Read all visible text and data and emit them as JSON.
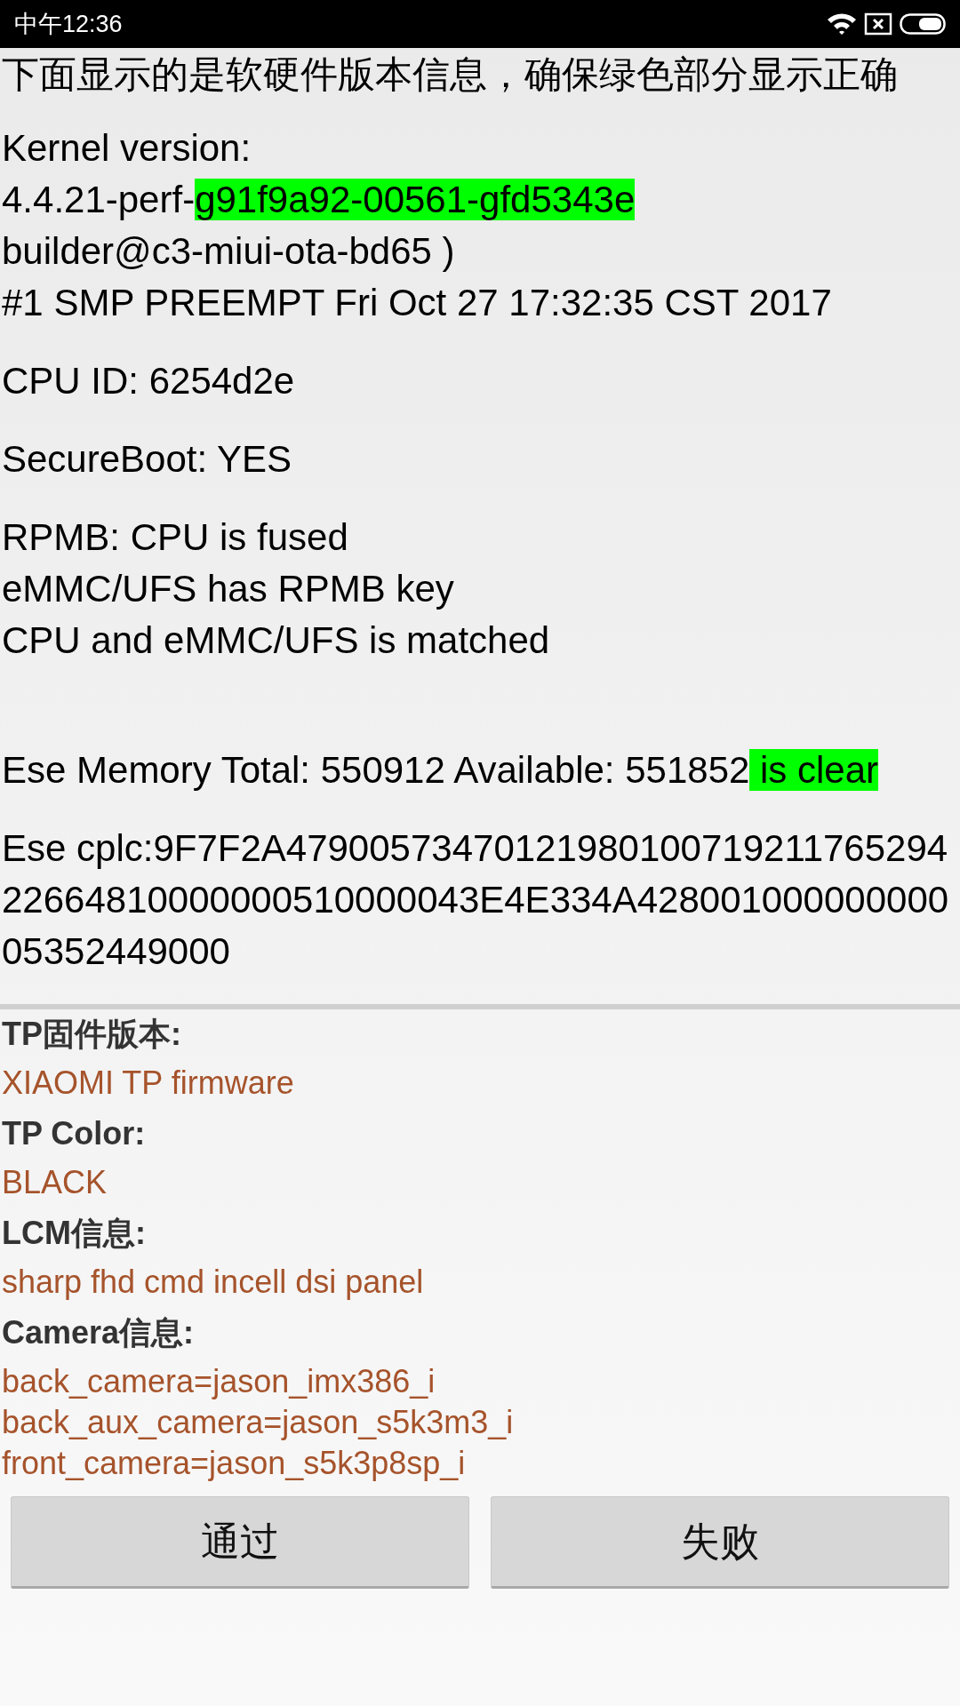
{
  "status_bar": {
    "time": "中午12:36"
  },
  "header": "下面显示的是软硬件版本信息，确保绿色部分显示正确",
  "info_blocks": [
    {
      "lines": [
        [
          {
            "text": "Kernel version:",
            "highlight": false
          }
        ],
        [
          {
            "text": "4.4.21-perf-",
            "highlight": false
          },
          {
            "text": "g91f9a92-00561-gfd5343e",
            "highlight": true
          }
        ],
        [
          {
            "text": "builder@c3-miui-ota-bd65 )",
            "highlight": false
          }
        ],
        [
          {
            "text": "#1 SMP PREEMPT Fri Oct 27 17:32:35 CST 2017",
            "highlight": false
          }
        ]
      ]
    },
    {
      "lines": [
        [
          {
            "text": "CPU ID: 6254d2e",
            "highlight": false
          }
        ]
      ]
    },
    {
      "lines": [
        [
          {
            "text": "SecureBoot: YES",
            "highlight": false
          }
        ]
      ]
    },
    {
      "lines": [
        [
          {
            "text": "RPMB: CPU is fused",
            "highlight": false
          }
        ],
        [
          {
            "text": "eMMC/UFS has RPMB key",
            "highlight": false
          }
        ],
        [
          {
            "text": "CPU and eMMC/UFS is matched",
            "highlight": false
          }
        ]
      ]
    },
    {
      "lines": [
        [
          {
            "text": "Ese Memory Total: 550912 Available: 551852",
            "highlight": false
          },
          {
            "text": " is clear",
            "highlight": true
          }
        ]
      ]
    },
    {
      "lines": [
        [
          {
            "text": "Ese cplc:9F7F2A4790057347012198010071921176529422664810000000510000043E4E334A42800100000000005352449000",
            "highlight": false
          }
        ]
      ]
    }
  ],
  "fields": [
    {
      "label": "TP固件版本:",
      "values": [
        "XIAOMI TP firmware"
      ]
    },
    {
      "label": "TP Color:",
      "values": [
        "BLACK"
      ]
    },
    {
      "label": "LCM信息:",
      "values": [
        "sharp fhd cmd incell dsi panel"
      ]
    },
    {
      "label": "Camera信息:",
      "values": [
        "back_camera=jason_imx386_i",
        "back_aux_camera=jason_s5k3m3_i",
        "front_camera=jason_s5k3p8sp_i"
      ]
    }
  ],
  "buttons": [
    "通过",
    "失败"
  ]
}
